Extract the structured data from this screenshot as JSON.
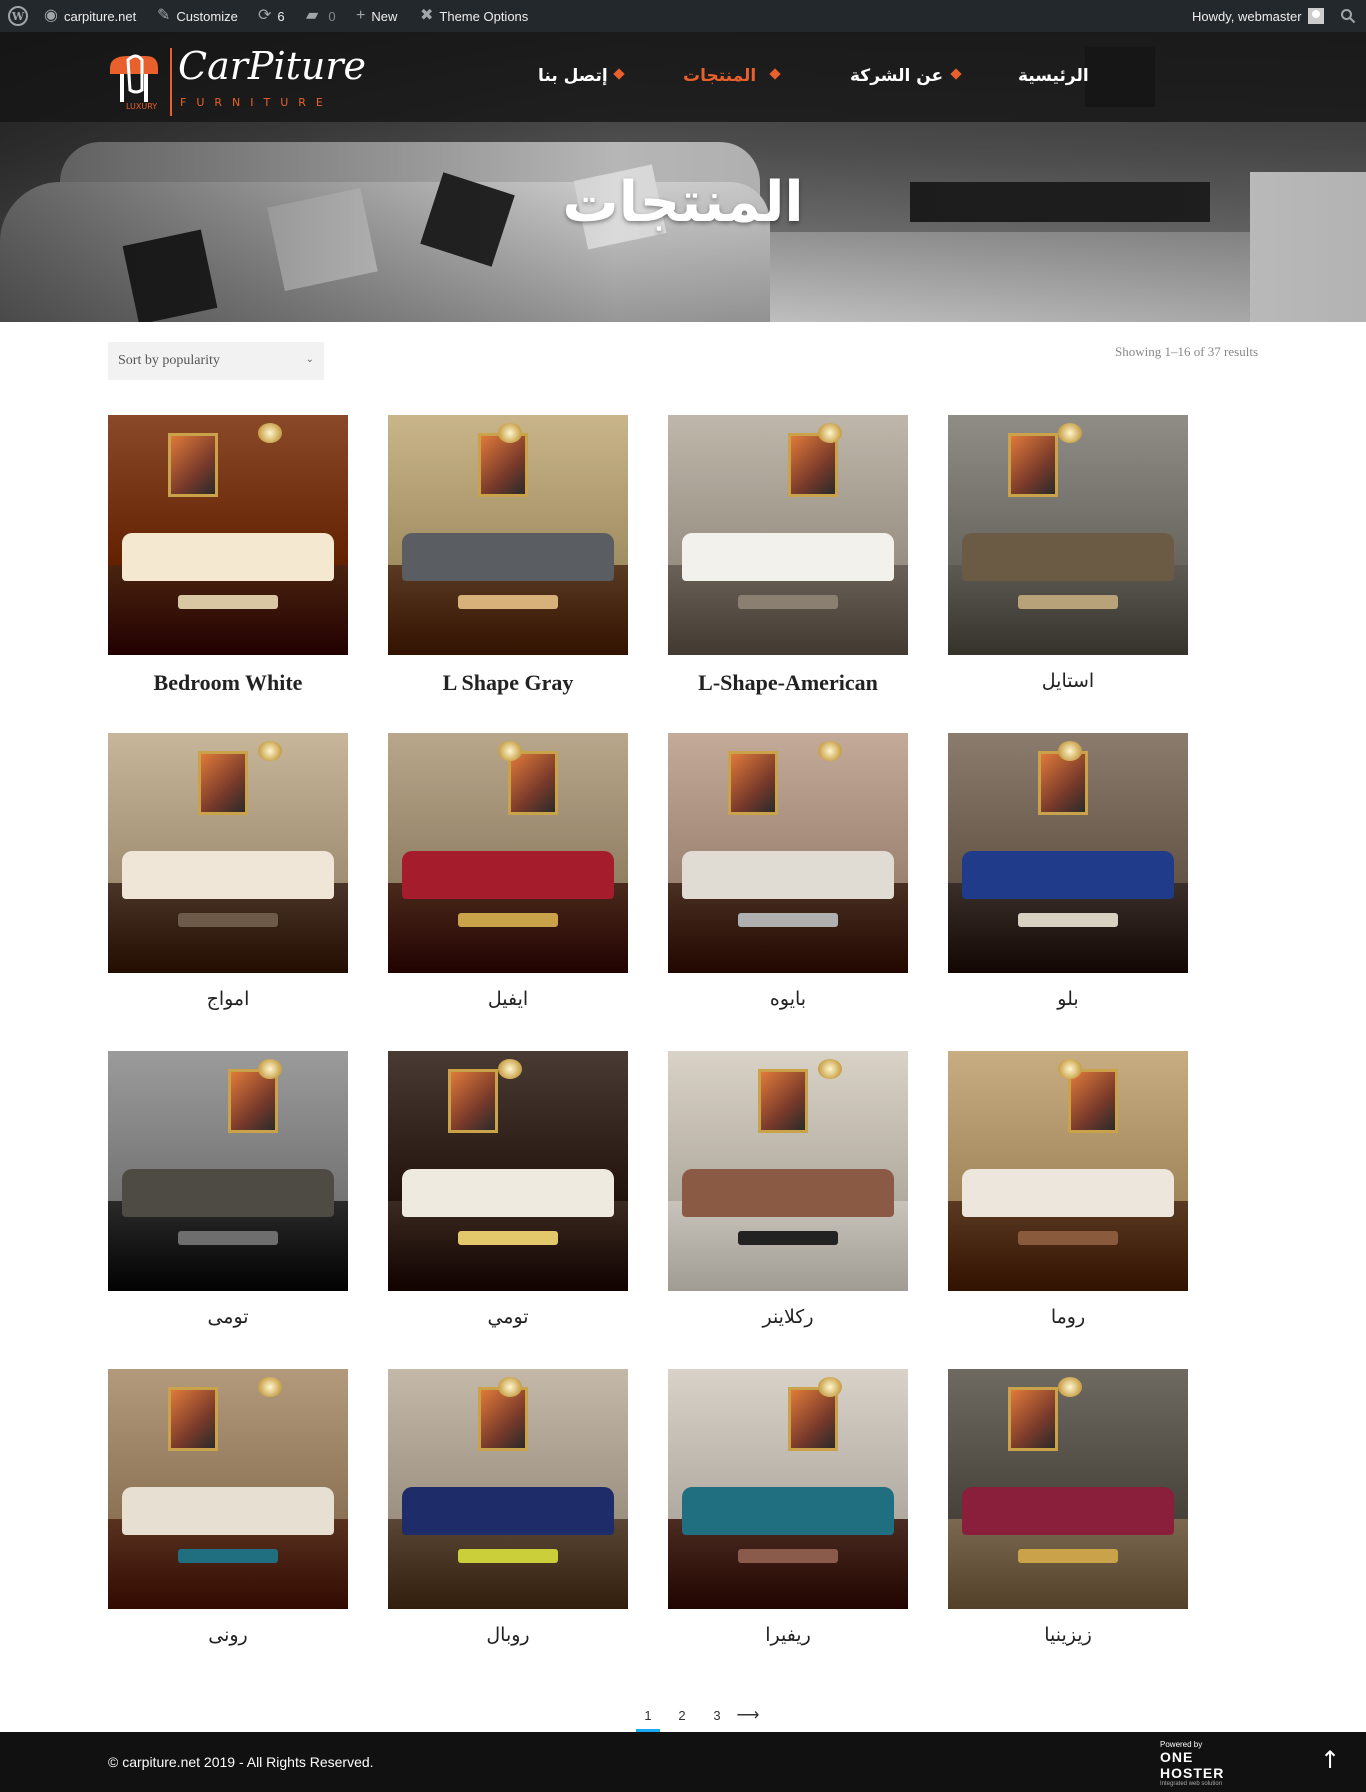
{
  "admin_bar": {
    "site_name": "carpiture.net",
    "customize": "Customize",
    "updates_count": "6",
    "comments_count": "0",
    "new": "New",
    "theme_options": "Theme Options",
    "greeting": "Howdy, webmaster"
  },
  "logo": {
    "name": "CarPiture",
    "sub": "FURNITURE",
    "badge": "LUXURY",
    "accent_color": "#e8602c"
  },
  "nav": {
    "items": [
      {
        "label": "الرئيسية",
        "active": false
      },
      {
        "label": "عن الشركة",
        "active": false
      },
      {
        "label": "المنتجات",
        "active": true
      },
      {
        "label": "إتصل بنا",
        "active": false
      }
    ]
  },
  "hero": {
    "title": "المنتجات"
  },
  "toolbar": {
    "sort_value": "Sort by popularity",
    "result_count": "Showing 1–16 of 37 results"
  },
  "products": [
    {
      "title": "Bedroom White"
    },
    {
      "title": "L Shape Gray"
    },
    {
      "title": "L-Shape-American"
    },
    {
      "title": "استايل"
    },
    {
      "title": "امواج"
    },
    {
      "title": "ايفيل"
    },
    {
      "title": "بايوه"
    },
    {
      "title": "بلو"
    },
    {
      "title": "تومى"
    },
    {
      "title": "تومي"
    },
    {
      "title": "ركلاينر"
    },
    {
      "title": "روما"
    },
    {
      "title": "رونى"
    },
    {
      "title": "روبال"
    },
    {
      "title": "ريفيرا"
    },
    {
      "title": "زيزينيا"
    }
  ],
  "pagination": {
    "pages": [
      "1",
      "2",
      "3"
    ],
    "current": "1",
    "next": "⟶"
  },
  "footer": {
    "copyright": "© carpiture.net 2019 - All Rights Reserved.",
    "powered_by": "Powered by",
    "hoster_name": "ONE HOSTER",
    "hoster_tagline": "Integrated web solution"
  }
}
